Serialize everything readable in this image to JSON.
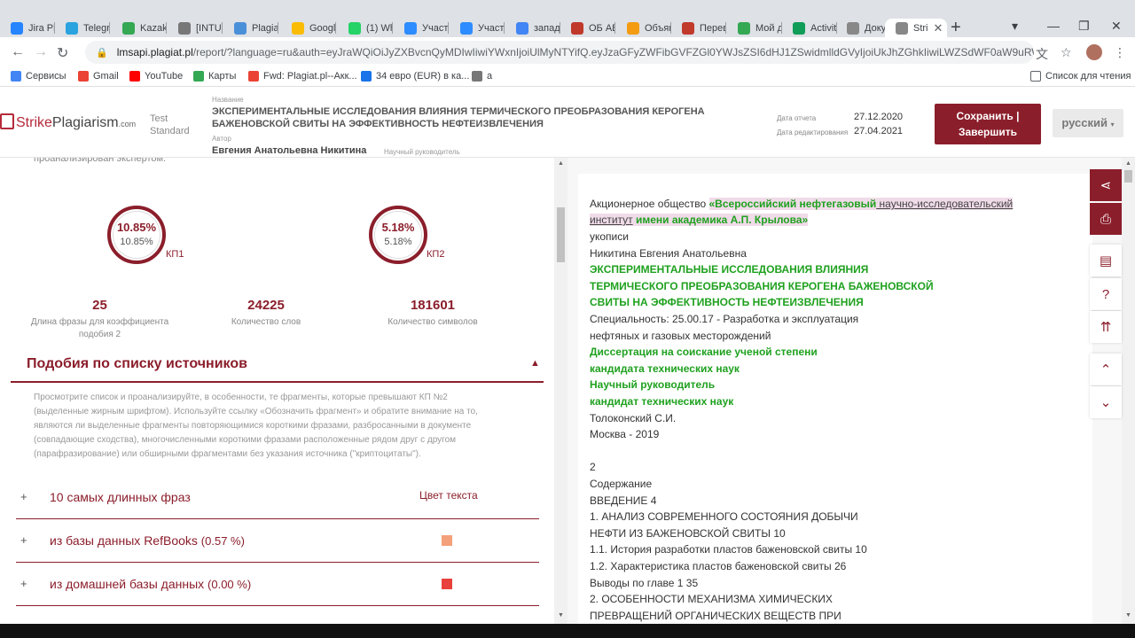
{
  "browser": {
    "tabs": [
      {
        "title": "Jira Pl",
        "color": "#2684ff"
      },
      {
        "title": "Telegr",
        "color": "#2aa3df"
      },
      {
        "title": "Kazakt",
        "color": "#34a853"
      },
      {
        "title": "[INTUI",
        "color": "#777777"
      },
      {
        "title": "Plagia",
        "color": "#4a90d9"
      },
      {
        "title": "Googl",
        "color": "#fbbc05"
      },
      {
        "title": "(1) Wh",
        "color": "#25d366"
      },
      {
        "title": "Участ",
        "color": "#2d8cff"
      },
      {
        "title": "Участ",
        "color": "#2d8cff"
      },
      {
        "title": "запад",
        "color": "#4285f4"
      },
      {
        "title": "ОБ АБ",
        "color": "#c0392b"
      },
      {
        "title": "Объяв",
        "color": "#f39c12"
      },
      {
        "title": "Перев",
        "color": "#c0392b"
      },
      {
        "title": "Мой д",
        "color": "#34a853"
      },
      {
        "title": "Activit",
        "color": "#0f9d58"
      },
      {
        "title": "Докуи",
        "color": "#888888"
      },
      {
        "title": "Stri",
        "color": "#888888"
      }
    ],
    "new_tab": "+",
    "url_host": "lmsapi.plagiat.pl",
    "url_rest": "/report/?language=ru&auth=eyJraWQiOiJyZXBvcnQyMDIwIiwiYWxnIjoiUlMyNTYifQ.eyJzaGFyZWFibGVFZGl0YWJsZSI6dHJ1ZSwidmlldGVyIjoiUkJhZGhkIiwiLWZSdWF0aW9uRW5hYmxl",
    "bookmarks": [
      {
        "label": "Сервисы",
        "color": "#4285f4"
      },
      {
        "label": "Gmail",
        "color": "#ea4335"
      },
      {
        "label": "YouTube",
        "color": "#ff0000"
      },
      {
        "label": "Карты",
        "color": "#34a853"
      },
      {
        "label": "Fwd: Plagiat.pl--Акк...",
        "color": "#ea4335"
      },
      {
        "label": "34 евро (EUR) в ка...",
        "color": "#1a73e8"
      },
      {
        "label": "a",
        "color": "#777777"
      }
    ],
    "reading_list": "Список для чтения"
  },
  "header": {
    "logo_strike": "Strike",
    "logo_plagiarism": "Plagiarism",
    "logo_com": ".com",
    "test_label": "Test",
    "standard_label": "Standard",
    "title_label": "Название",
    "title": "ЭКСПЕРИМЕНТАЛЬНЫЕ ИССЛЕДОВАНИЯ ВЛИЯНИЯ ТЕРМИЧЕСКОГО ПРЕОБРАЗОВАНИЯ КЕРОГЕНА БАЖЕНОВСКОЙ СВИТЫ НА ЭФФЕКТИВНОСТЬ НЕФТЕИЗВЛЕЧЕНИЯ",
    "author_label": "Автор",
    "author": "Евгения Анатольевна Никитина",
    "supervisor_label": "Научный руководитель",
    "report_date_label": "Дата отчета",
    "report_date": "27.12.2020",
    "edit_date_label": "Дата редактирования",
    "edit_date": "27.04.2021",
    "save_line1": "Сохранить |",
    "save_line2": "Завершить",
    "language": "русский"
  },
  "left": {
    "cutoff_line": "проанализирован экспертом.",
    "gauge1": {
      "big": "10.85%",
      "small": "10.85%",
      "label": "КП1"
    },
    "gauge2": {
      "big": "5.18%",
      "small": "5.18%",
      "label": "КП2"
    },
    "stats": [
      {
        "num": "25",
        "label": "Длина фразы для коэффициента подобия 2"
      },
      {
        "num": "24225",
        "label": "Количество слов"
      },
      {
        "num": "181601",
        "label": "Количество символов"
      }
    ],
    "section_title": "Подобия по списку источников",
    "help_text": "Просмотрите список и проанализируйте, в особенности, те фрагменты, которые превышают КП №2 (выделенные жирным шрифтом). Используйте ссылку «Обозначить фрагмент» и обратите внимание на то, являются ли выделенные фрагменты повторяющимися короткими фразами, разбросанными в документе (совпадающие сходства), многочисленными короткими фразами расположенные рядом друг с другом (парафразирование) или обширными фрагментами без указания источника (\"криптоцитаты\").",
    "color_column": "Цвет текста",
    "rows": [
      {
        "name": "10 самых длинных фраз",
        "pct": "",
        "color": ""
      },
      {
        "name": "из базы данных RefBooks",
        "pct": "(0.57 %)",
        "color": "#f4a07a"
      },
      {
        "name": "из домашней базы данных",
        "pct": "(0.00 %)",
        "color": "#e8403a"
      }
    ]
  },
  "document": {
    "org_prefix": "Акционерное общество ",
    "org_bold1": "«Всероссийский нефтегазовый",
    "org_under1": " научно-исследовательский",
    "org_under2": "институт",
    "org_bold2": " имени академика А.П. Крылова»",
    "lines": [
      {
        "text": "укописи",
        "green": false
      },
      {
        "text": "Никитина Евгения Анатольевна",
        "green": false
      },
      {
        "text": " ЭКСПЕРИМЕНТАЛЬНЫЕ ИССЛЕДОВАНИЯ ВЛИЯНИЯ",
        "green": true
      },
      {
        "text": "ТЕРМИЧЕСКОГО ПРЕОБРАЗОВАНИЯ КЕРОГЕНА БАЖЕНОВСКОЙ",
        "green": true
      },
      {
        "text": "СВИТЫ НА ЭФФЕКТИВНОСТЬ НЕФТЕИЗВЛЕЧЕНИЯ",
        "green": true
      },
      {
        "text": "Специальность: 25.00.17 - Разработка и эксплуатация",
        "green": false
      },
      {
        "text": "нефтяных и газовых месторождений",
        "green": false
      },
      {
        "text": " Диссертация на соискание ученой степени",
        "green": true
      },
      {
        "text": "кандидата технических наук",
        "green": true
      },
      {
        "text": "Научный руководитель",
        "green": true
      },
      {
        "text": "кандидат технических наук",
        "green": true
      },
      {
        "text": "Толоконский С.И.",
        "green": false
      },
      {
        "text": "Москва - 2019",
        "green": false
      },
      {
        "text": "",
        "green": false
      },
      {
        "text": "2",
        "green": false
      },
      {
        "text": "Содержание",
        "green": false
      },
      {
        "text": "ВВЕДЕНИЕ 4",
        "green": false
      },
      {
        "text": "1. АНАЛИЗ СОВРЕМЕННОГО СОСТОЯНИЯ ДОБЫЧИ",
        "green": false
      },
      {
        "text": "НЕФТИ ИЗ БАЖЕНОВСКОЙ СВИТЫ 10",
        "green": false
      },
      {
        "text": "1.1. История разработки пластов баженовской свиты 10",
        "green": false
      },
      {
        "text": "1.2. Характеристика пластов баженовской свиты 26",
        "green": false
      },
      {
        "text": "Выводы по главе 1 35",
        "green": false
      },
      {
        "text": "2. ОСОБЕННОСТИ МЕХАНИЗМА ХИМИЧЕСКИХ",
        "green": false
      },
      {
        "text": "ПРЕВРАЩЕНИЙ ОРГАНИЧЕСКИХ ВЕЩЕСТВ ПРИ",
        "green": false
      }
    ]
  }
}
